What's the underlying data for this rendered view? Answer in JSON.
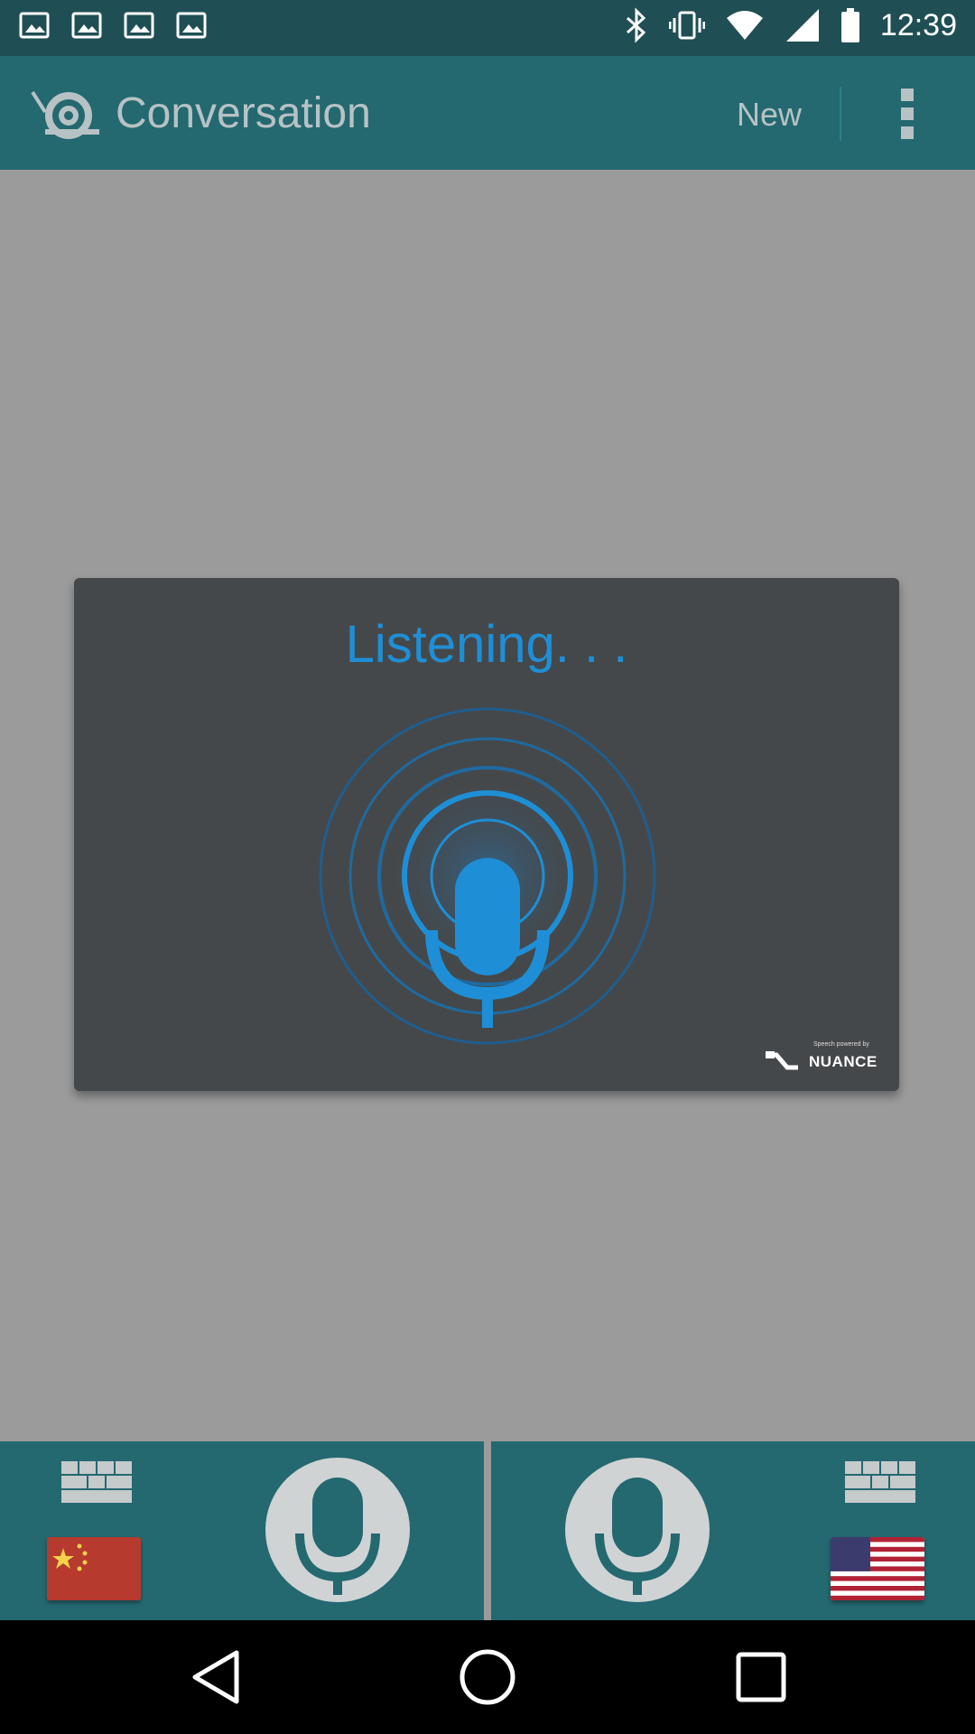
{
  "status_bar": {
    "time": "12:39",
    "left_icons": [
      "image-icon",
      "image-icon",
      "image-icon",
      "image-icon"
    ],
    "right_icons": [
      "bluetooth-icon",
      "vibrate-icon",
      "wifi-icon",
      "signal-icon",
      "battery-icon"
    ]
  },
  "app_bar": {
    "title": "Conversation",
    "new_label": "New",
    "logo_icon": "snail-at-logo-icon",
    "menu_icon": "more-vertical-icon"
  },
  "dialog": {
    "status_text": "Listening. . .",
    "mic_icon": "microphone-icon",
    "powered_by_small": "Speech powered by",
    "powered_by_brand": "NUANCE"
  },
  "bottom_bar": {
    "left": {
      "keyboard_icon": "keyboard-icon",
      "flag_icon": "china-flag-icon",
      "mic_icon": "microphone-icon"
    },
    "right": {
      "keyboard_icon": "keyboard-icon",
      "flag_icon": "us-flag-icon",
      "mic_icon": "microphone-icon"
    }
  },
  "nav_bar": {
    "buttons": [
      "back-triangle-icon",
      "home-circle-icon",
      "recents-square-icon"
    ]
  },
  "colors": {
    "app_bar": "#246870",
    "status_bar": "#1f4f54",
    "overlay": "#9b9b9b",
    "dialog": "#45484a",
    "accent_blue": "#1e8fd6"
  }
}
